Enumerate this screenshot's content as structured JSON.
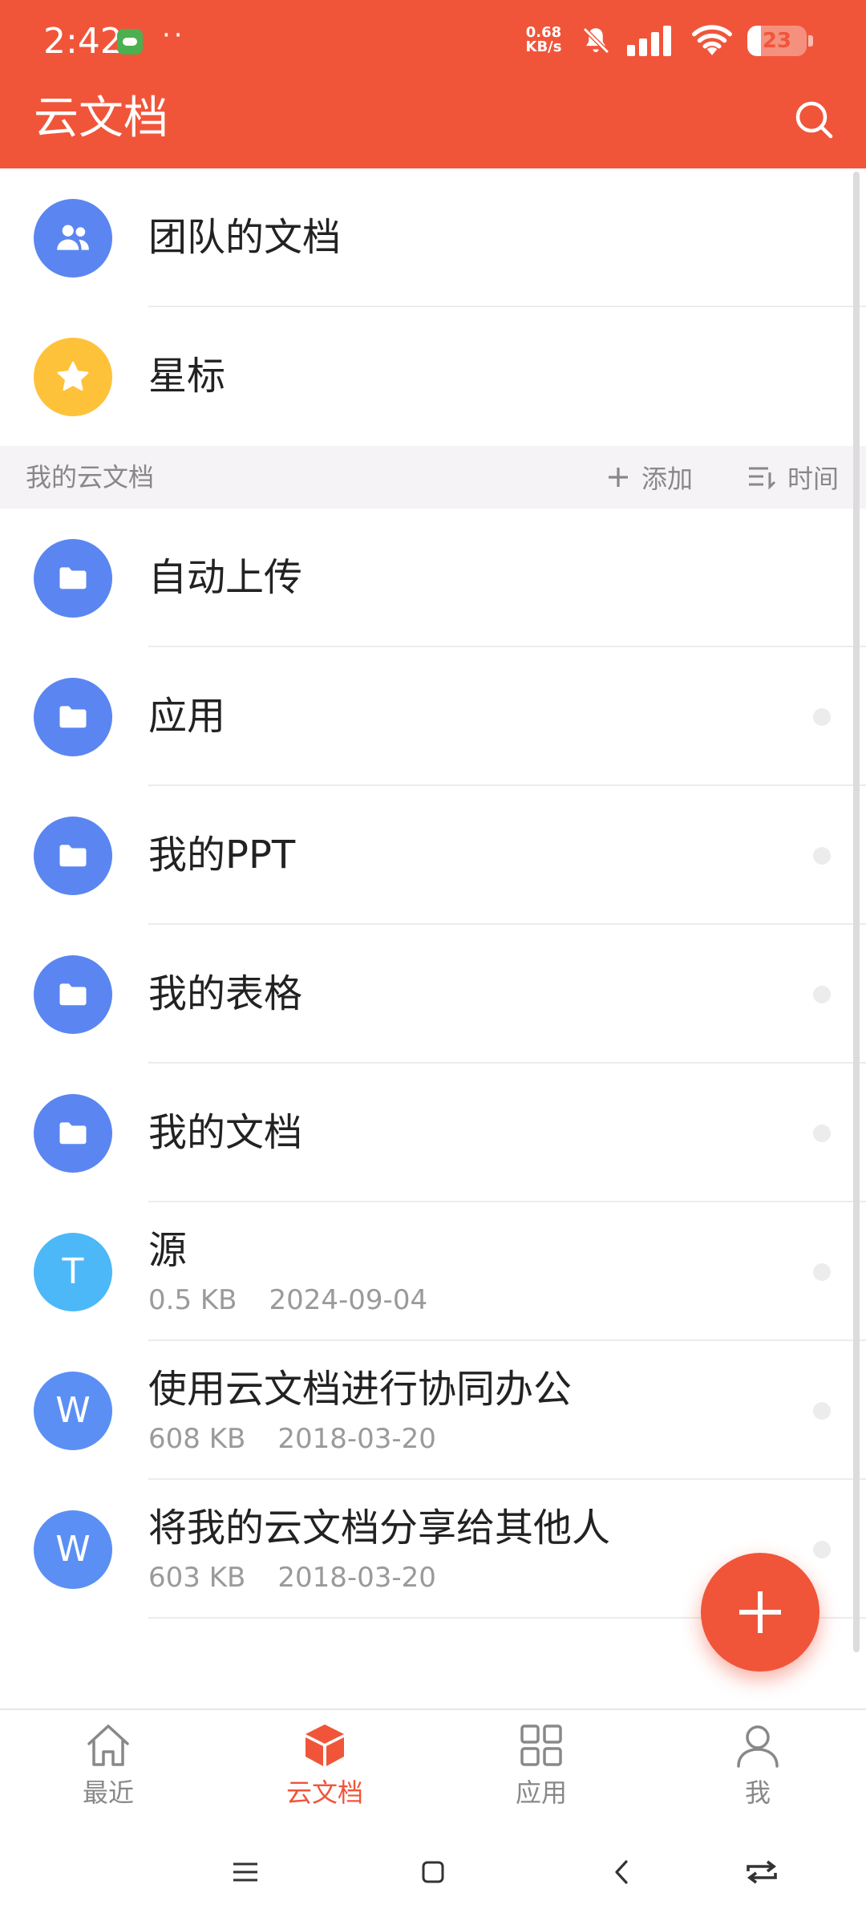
{
  "status_bar": {
    "time": "2:42",
    "dots": "··",
    "net_speed_value": "0.68",
    "net_speed_unit": "KB/s",
    "battery_level": "23",
    "battery_fraction": 0.23
  },
  "header": {
    "title": "云文档",
    "search_icon": "search-icon"
  },
  "top_items": [
    {
      "label": "团队的文档",
      "icon": "team-icon",
      "color": "#5b86f1"
    },
    {
      "label": "星标",
      "icon": "star-icon",
      "color": "#fec23a"
    }
  ],
  "section": {
    "title": "我的云文档",
    "add_label": "添加",
    "sort_label": "时间"
  },
  "files": [
    {
      "name": "自动上传",
      "type": "folder",
      "color": "#5b86f1",
      "has_more": false
    },
    {
      "name": "应用",
      "type": "folder",
      "color": "#5b86f1",
      "has_more": true
    },
    {
      "name": "我的PPT",
      "type": "folder",
      "color": "#5b86f1",
      "has_more": true
    },
    {
      "name": "我的表格",
      "type": "folder",
      "color": "#5b86f1",
      "has_more": true
    },
    {
      "name": "我的文档",
      "type": "folder",
      "color": "#5b86f1",
      "has_more": true
    },
    {
      "name": "源",
      "type": "text",
      "letter": "T",
      "color": "#4db8f8",
      "size": "0.5 KB",
      "date": "2024-09-04",
      "has_more": true
    },
    {
      "name": "使用云文档进行协同办公",
      "type": "word",
      "letter": "W",
      "color": "#5b8ff4",
      "size": "608 KB",
      "date": "2018-03-20",
      "has_more": true
    },
    {
      "name": "将我的云文档分享给其他人",
      "type": "word",
      "letter": "W",
      "color": "#5b8ff4",
      "size": "603 KB",
      "date": "2018-03-20",
      "has_more": true
    }
  ],
  "fab": {
    "icon": "plus-icon"
  },
  "bottom_nav": [
    {
      "label": "最近",
      "icon": "home-icon",
      "active": false
    },
    {
      "label": "云文档",
      "icon": "cloud-box-icon",
      "active": true
    },
    {
      "label": "应用",
      "icon": "apps-grid-icon",
      "active": false
    },
    {
      "label": "我",
      "icon": "profile-icon",
      "active": false
    }
  ],
  "colors": {
    "brand": "#f0553a",
    "folder_blue": "#5b86f1",
    "star_yellow": "#fec23a"
  }
}
